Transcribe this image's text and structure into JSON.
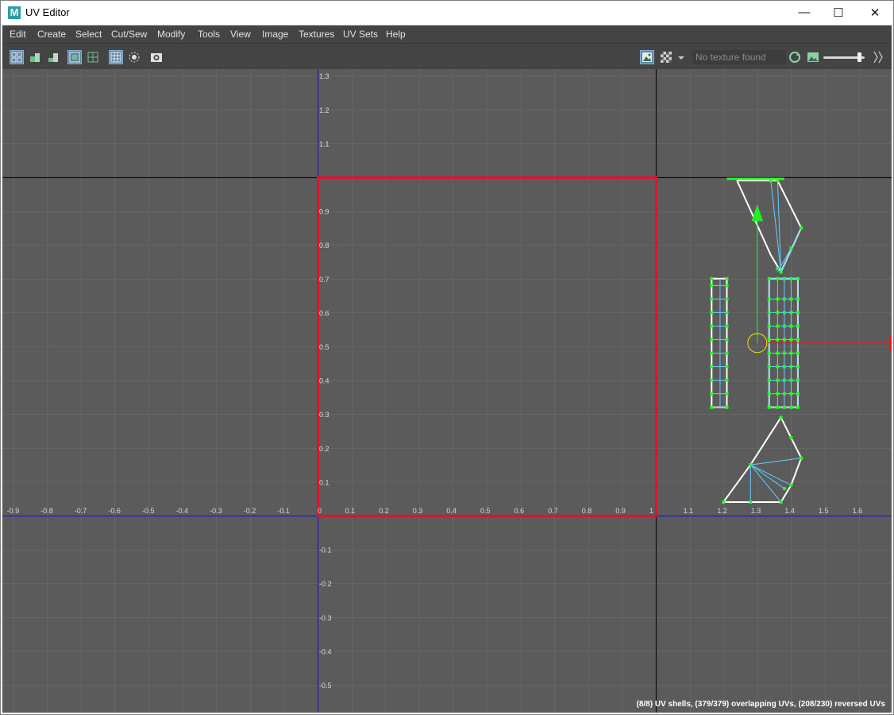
{
  "window": {
    "app_icon": "M",
    "title": "UV Editor",
    "controls": {
      "minimize": "—",
      "maximize": "☐",
      "close": "✕"
    }
  },
  "menu": [
    "Edit",
    "Create",
    "Select",
    "Cut/Sew",
    "Modify",
    "Tools",
    "View",
    "Image",
    "Textures",
    "UV Sets",
    "Help"
  ],
  "toolbar": {
    "left_icons": [
      "uv-toolkit-icon",
      "uv-shell-icon",
      "uv-layout-icon",
      "texture-borders-icon",
      "edge-display-icon",
      "grid-icon",
      "isolate-icon",
      "snapshot-icon"
    ],
    "texture_field": "No texture found",
    "right_icons": [
      "image-display-icon",
      "checker-icon",
      "dropdown-arrow-icon",
      "sync-icon",
      "image-ratio-icon",
      "exposure-slider-icon",
      "collapse-icon"
    ],
    "exposure_slider_value": 0.9
  },
  "viewport": {
    "ticks_x": [
      "-0.9",
      "-0.8",
      "-0.7",
      "-0.6",
      "-0.5",
      "-0.4",
      "-0.3",
      "-0.2",
      "-0.1",
      "0",
      "0.1",
      "0.2",
      "0.3",
      "0.4",
      "0.5",
      "0.6",
      "0.7",
      "0.8",
      "0.9",
      "1",
      "1.1",
      "1.2",
      "1.3",
      "1.4",
      "1.5",
      "1.6"
    ],
    "ticks_y": [
      "-0.5",
      "-0.4",
      "-0.3",
      "-0.2",
      "-0.1",
      "0.1",
      "0.2",
      "0.3",
      "0.4",
      "0.5",
      "0.6",
      "0.7",
      "0.8",
      "0.9",
      "1.1",
      "1.2",
      "1.3"
    ],
    "colors": {
      "background": "#5b5b5b",
      "grid": "#666666",
      "axis": "#1c1ccc",
      "uv_border": "#e0122e",
      "shell_edge": "#ffffff",
      "inner_edge": "#66ccff",
      "uv_point": "#22ff22",
      "move_y": "#22ee22",
      "move_x": "#ff1010",
      "pivot": "#e6e600"
    },
    "status_text": "(8/8) UV shells, (379/379) overlapping UVs, (208/230) reversed UVs"
  }
}
